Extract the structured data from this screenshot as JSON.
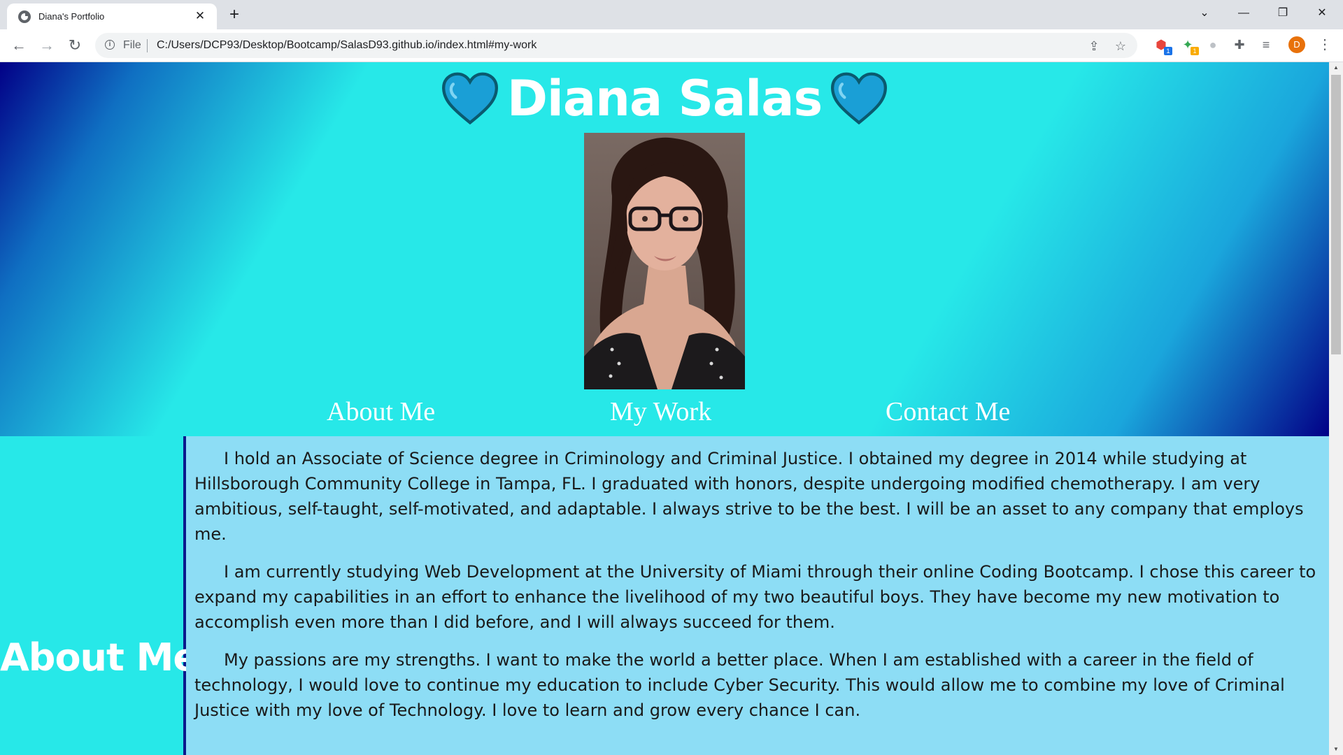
{
  "browser": {
    "tab_title": "Diana's Portfolio",
    "address_scheme": "File",
    "address_url": "C:/Users/DCP93/Desktop/Bootcamp/SalasD93.github.io/index.html#my-work",
    "profile_initial": "D",
    "extension_badges": [
      "1",
      "1"
    ]
  },
  "header": {
    "title": "Diana Salas",
    "heart_color": "#1a9fd6",
    "photo_alt": "Diana Salas portrait"
  },
  "nav": {
    "items": [
      {
        "label": "About Me"
      },
      {
        "label": "My Work"
      },
      {
        "label": "Contact Me"
      }
    ]
  },
  "about": {
    "heading": "About Me",
    "paragraphs": [
      "I hold an Associate of Science degree in Criminology and Criminal Justice. I obtained my degree in 2014 while studying at Hillsborough Community College in Tampa, FL. I graduated with honors, despite undergoing modified chemotherapy. I am very ambitious, self-taught, self-motivated, and adaptable. I always strive to be the best. I will be an asset to any company that employs me.",
      "I am currently studying Web Development at the University of Miami through their online Coding Bootcamp. I chose this career to expand my capabilities in an effort to enhance the livelihood of my two beautiful boys. They have become my new motivation to accomplish even more than I did before, and I will always succeed for them.",
      "My passions are my strengths. I want to make the world a better place. When I am established with a career in the field of technology, I would love to continue my education to include Cyber Security. This would allow me to combine my love of Criminal Justice with my love of Technology. I love to learn and grow every chance I can."
    ]
  },
  "colors": {
    "accent_cyan": "#27e8e8",
    "about_body_bg": "#8dddf5",
    "deep_blue": "#020087"
  }
}
